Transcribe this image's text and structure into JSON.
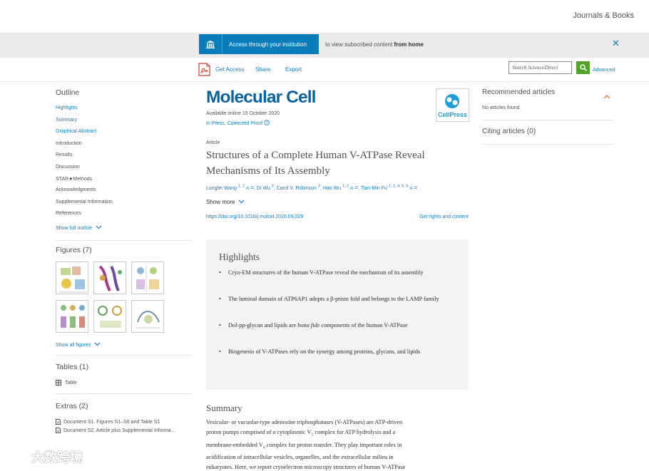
{
  "topbar": {
    "journals_books": "Journals & Books"
  },
  "banner": {
    "access_label": "Access through your institution",
    "sub_prefix": "to view subscribed content",
    "sub_bold": "from home",
    "close": "✕"
  },
  "toolbar": {
    "get_access": "Get Access",
    "share": "Share",
    "export": "Export",
    "search_placeholder": "Search ScienceDirect",
    "advanced": "Advanced"
  },
  "outline": {
    "title": "Outline",
    "items": [
      {
        "label": "Highlights",
        "link": true
      },
      {
        "label": "Summary",
        "link": true
      },
      {
        "label": "Graphical Abstract",
        "link": true
      },
      {
        "label": "Introduction",
        "link": false
      },
      {
        "label": "Results",
        "link": false
      },
      {
        "label": "Discussion",
        "link": false
      },
      {
        "label": "STAR★Methods",
        "link": false
      },
      {
        "label": "Acknowledgments",
        "link": false
      },
      {
        "label": "Supplemental Information",
        "link": false
      },
      {
        "label": "References",
        "link": false
      }
    ],
    "show_full": "Show full outline"
  },
  "figures": {
    "title": "Figures (7)",
    "show_all": "Show all figures"
  },
  "tables": {
    "title": "Tables (1)",
    "items": [
      "Table"
    ]
  },
  "extras": {
    "title": "Extras (2)",
    "items": [
      "Document S1. Figures S1–S6 and Table S1",
      "Document S2. Article plus Supplemental Informa..."
    ]
  },
  "article": {
    "journal": "Molecular Cell",
    "publisher_logo": "CellPress",
    "available": "Available online 15 October 2020",
    "status": "In Press, Corrected Proof",
    "type": "Article",
    "title_line1": "Structures of a Complete Human V-ATPase Reveal",
    "title_line2": "Mechanisms of Its Assembly",
    "authors": [
      {
        "name": "Longfei Wang",
        "sup": "1, 2"
      },
      {
        "name": "Di Wu",
        "sup": "3"
      },
      {
        "name": "Carol V. Robinson",
        "sup": "3"
      },
      {
        "name": "Hao Wu",
        "sup": "1, 2"
      },
      {
        "name": "Tian-Min Fu",
        "sup": "1, 2, 4, 5, 6"
      }
    ],
    "show_more": "Show more",
    "doi": "https://doi.org/10.1016/j.molcel.2020.09.029",
    "rights": "Get rights and content"
  },
  "highlights": {
    "title": "Highlights",
    "items": [
      "Cryo-EM structures of the human V-ATPase reveal the mechanism of its assembly",
      "The luminal domain of ATP6AP1 adopts a β-prism fold and belongs to the LAMP family",
      "Dol-pp-glycan and lipids are bona fide components of the human V-ATPase",
      "Biogenesis of V-ATPases rely on the synergy among proteins, glycans, and lipids"
    ]
  },
  "summary": {
    "title": "Summary",
    "line1": "Vesicular- or vacuolar-type adenosine triphosphatases (V-ATPases) are ATP-driven",
    "line2_pre": "proton pumps comprised of a cytoplasmic V",
    "line2_sub": "1",
    "line2_post": " complex for ATP hydrolysis and a",
    "line3_pre": "membrane-embedded V",
    "line3_sub": "o",
    "line3_post": " complex for proton transfer. They play important roles in",
    "line4": "acidification of intracellular vesicles, organelles, and the extracellular milieu in",
    "line5": "eukaryotes. Here, we report cryoelectron microscopy structures of human V-ATPase"
  },
  "recommended": {
    "title": "Recommended articles",
    "empty": "No articles found."
  },
  "citing": {
    "title": "Citing articles (0)"
  },
  "watermark": {
    "text": "大数跨境"
  },
  "colors": {
    "link": "#0c7dbb",
    "journal": "#0a62a1",
    "search_green": "#53a32b",
    "highlights_bg": "#f3f3f3"
  }
}
